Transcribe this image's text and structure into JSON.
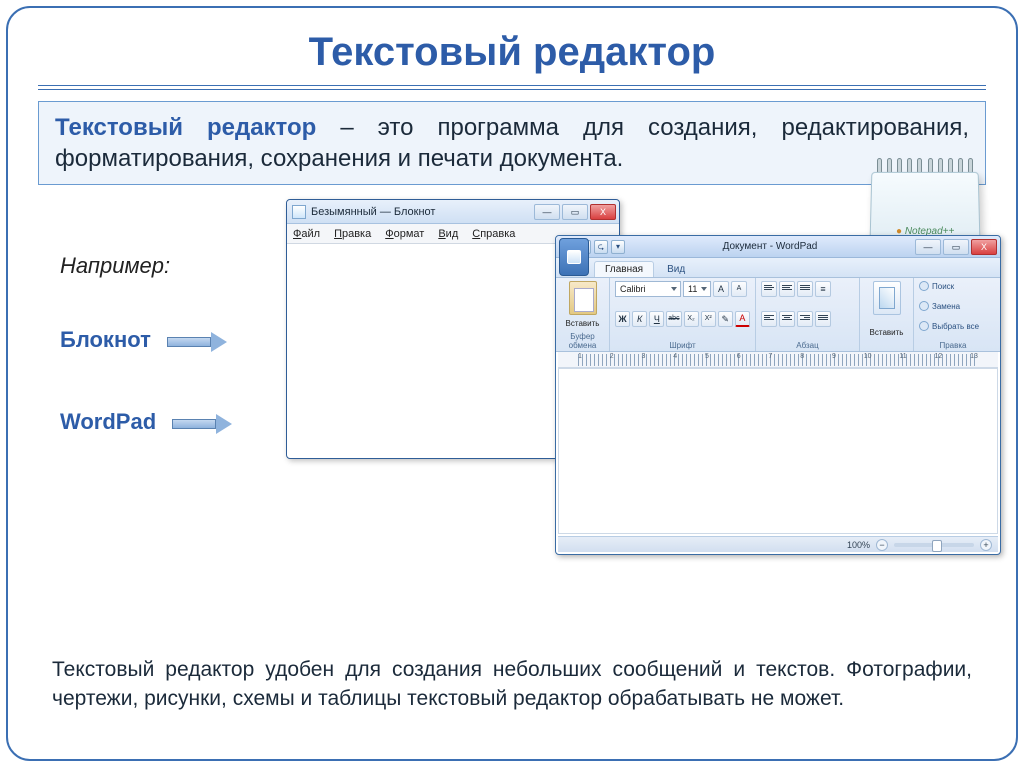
{
  "title": "Текстовый редактор",
  "definition": {
    "term": "Текстовый редактор",
    "rest": " – это программа для создания, редактирования, форматирования, сохранения и печати документа."
  },
  "example_label": "Например:",
  "products": {
    "notepad": "Блокнот",
    "wordpad": "WordPad"
  },
  "notepad_window": {
    "title": "Безымянный — Блокнот",
    "menu": [
      "Файл",
      "Правка",
      "Формат",
      "Вид",
      "Справка"
    ],
    "controls": {
      "min": "—",
      "max": "▭",
      "close": "X"
    }
  },
  "wordpad_window": {
    "title": "Документ - WordPad",
    "qat": [
      "⎘",
      "⮌",
      "⮎",
      "▾"
    ],
    "tabs": {
      "home": "Главная",
      "view": "Вид"
    },
    "ribbon": {
      "clipboard": {
        "paste": "Вставить",
        "label": "Буфер обмена"
      },
      "font": {
        "name": "Calibri",
        "size": "11",
        "grow": "A",
        "shrink": "A",
        "bold": "Ж",
        "italic": "К",
        "underline": "Ч",
        "strike": "abc",
        "sub": "X₂",
        "sup": "X²",
        "highlight": "✎",
        "color": "A",
        "label": "Шрифт"
      },
      "paragraph": {
        "label": "Абзац"
      },
      "insert": {
        "btn": "Вставить",
        "label": ""
      },
      "editing": {
        "find": "Поиск",
        "replace": "Замена",
        "select": "Выбрать все",
        "label": "Правка"
      }
    },
    "ruler_nums": [
      "1",
      "2",
      "3",
      "4",
      "5",
      "6",
      "7",
      "8",
      "9",
      "10",
      "11",
      "12",
      "13"
    ],
    "status": {
      "zoom": "100%",
      "minus": "−",
      "plus": "+"
    },
    "controls": {
      "min": "—",
      "max": "▭",
      "close": "X"
    }
  },
  "deco_brand": "Notepad++",
  "bottom_text": "Текстовый редактор удобен для создания небольших сообщений и текстов. Фотографии, чертежи, рисунки, схемы и таблицы текстовый редактор обрабатывать не может."
}
